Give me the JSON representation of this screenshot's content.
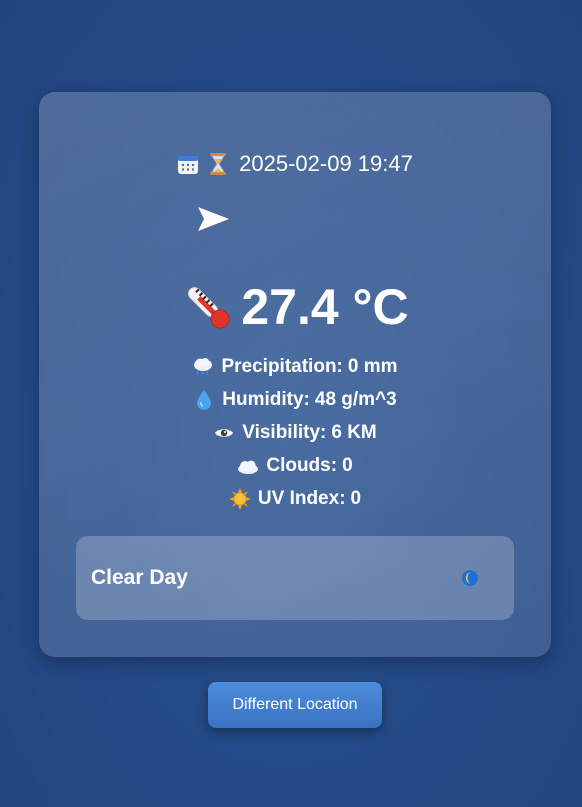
{
  "header": {
    "datetime": "2025-02-09 19:47",
    "icons": [
      "calendar-icon",
      "hourglass-icon",
      "navigation-arrow-icon"
    ]
  },
  "current": {
    "temperature": "27.4 °C",
    "temperature_icon": "thermometer-icon"
  },
  "stats": [
    {
      "icon": "rain-cloud-icon",
      "label": "Precipitation:",
      "value": "0 mm"
    },
    {
      "icon": "droplet-icon",
      "label": "Humidity:",
      "value": "48 g/m^3"
    },
    {
      "icon": "eye-icon",
      "label": "Visibility:",
      "value": "6 KM"
    },
    {
      "icon": "cloud-icon",
      "label": "Clouds:",
      "value": "0"
    },
    {
      "icon": "sun-icon",
      "label": "UV Index:",
      "value": "0"
    }
  ],
  "condition": {
    "name": "Clear Day",
    "icon": "crescent-moon-icon"
  },
  "actions": {
    "different_location_label": "Different Location"
  },
  "colors": {
    "background": "#244a88",
    "button": "#4683d2",
    "text": "#ffffff"
  }
}
